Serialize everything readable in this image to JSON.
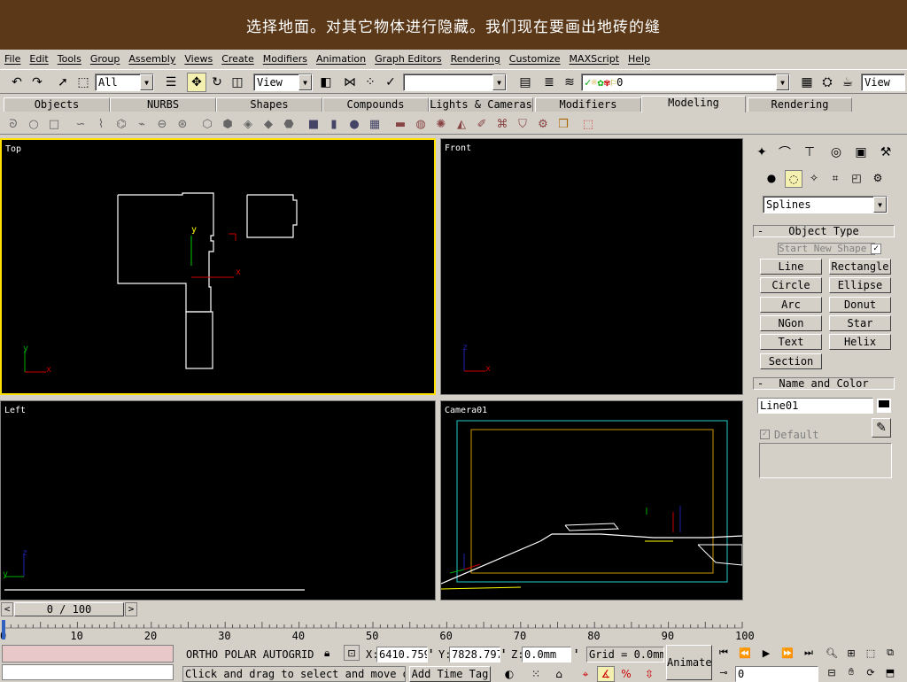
{
  "caption": "选择地面。对其它物体进行隐藏。我们现在要画出地砖的缝",
  "menu": [
    "File",
    "Edit",
    "Tools",
    "Group",
    "Assembly",
    "Views",
    "Create",
    "Modifiers",
    "Animation",
    "Graph Editors",
    "Rendering",
    "Customize",
    "MAXScript",
    "Help"
  ],
  "toolbar": {
    "selection_filter": "All",
    "ref_coord": "View",
    "named_selection": "",
    "layer": "0",
    "render_view": "View"
  },
  "tabs": [
    "Objects",
    "NURBS",
    "Shapes",
    "Compounds",
    "Lights & Cameras",
    "Modifiers",
    "Modeling",
    "Rendering"
  ],
  "active_tab": "Modeling",
  "viewports": {
    "top": "Top",
    "front": "Front",
    "left": "Left",
    "camera": "Camera01"
  },
  "axis_labels": {
    "x": "x",
    "y": "y",
    "z": "z"
  },
  "panel": {
    "category_dropdown": "Splines",
    "object_type_title": "Object Type",
    "start_new_shape": "Start New Shape",
    "buttons": [
      "Line",
      "Rectangle",
      "Circle",
      "Ellipse",
      "Arc",
      "Donut",
      "NGon",
      "Star",
      "Text",
      "Helix",
      "Section"
    ],
    "name_color_title": "Name and Color",
    "name_value": "Line01",
    "default_label": "Default"
  },
  "timeline": {
    "frame_display": "0 / 100",
    "ticks": [
      "0",
      "10",
      "20",
      "30",
      "40",
      "50",
      "60",
      "70",
      "80",
      "90",
      "100"
    ]
  },
  "status": {
    "snap_modes": "ORTHO  POLAR  AUTOGRID",
    "x_label": "X:",
    "x_value": "6410.759",
    "y_label": "Y:",
    "y_value": "7828.797",
    "z_label": "Z:",
    "z_value": "0.0mm",
    "grid": "Grid = 0.0mm",
    "prompt": "Click and drag to select and move o",
    "add_time_tag": "Add Time Tag",
    "animate": "Animate",
    "frame_field": "0"
  }
}
